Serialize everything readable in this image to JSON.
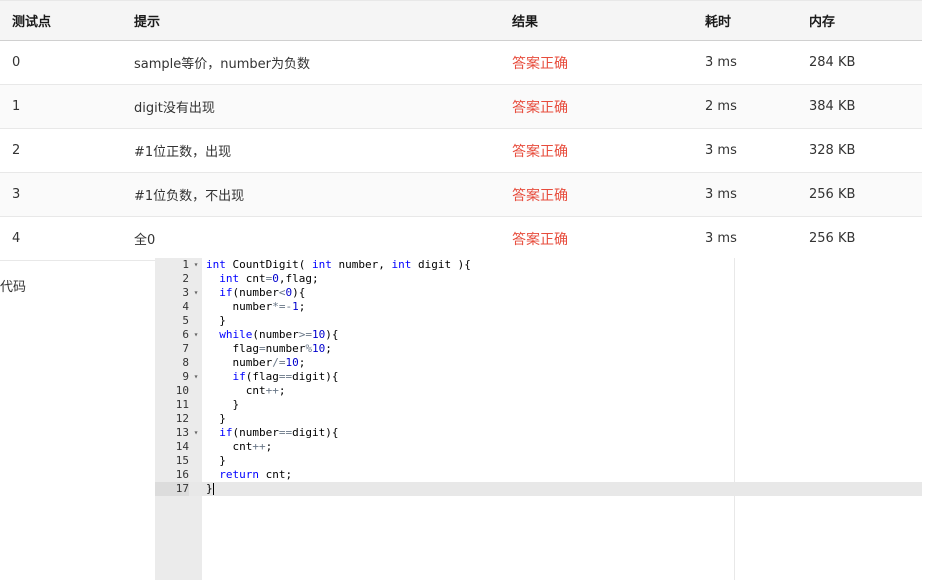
{
  "table": {
    "headers": {
      "case": "测试点",
      "hint": "提示",
      "result": "结果",
      "time": "耗时",
      "memory": "内存"
    },
    "rows": [
      {
        "case": "0",
        "hint": "sample等价，number为负数",
        "result": "答案正确",
        "time": "3 ms",
        "memory": "284 KB"
      },
      {
        "case": "1",
        "hint": "digit没有出现",
        "result": "答案正确",
        "time": "2 ms",
        "memory": "384 KB"
      },
      {
        "case": "2",
        "hint": "#1位正数，出现",
        "result": "答案正确",
        "time": "3 ms",
        "memory": "328 KB"
      },
      {
        "case": "3",
        "hint": "#1位负数，不出现",
        "result": "答案正确",
        "time": "3 ms",
        "memory": "256 KB"
      },
      {
        "case": "4",
        "hint": "全0",
        "result": "答案正确",
        "time": "3 ms",
        "memory": "256 KB"
      }
    ]
  },
  "code_label": "代码",
  "editor": {
    "active_line": 17,
    "colors": {
      "keyword": "#0000ff",
      "number": "#0000cd",
      "result": "#e74c3c"
    },
    "lines": [
      {
        "n": "1",
        "fold": true,
        "code": "int CountDigit( int number, int digit ){"
      },
      {
        "n": "2",
        "fold": false,
        "code": "  int cnt=0,flag;"
      },
      {
        "n": "3",
        "fold": true,
        "code": "  if(number<0){"
      },
      {
        "n": "4",
        "fold": false,
        "code": "    number*=-1;"
      },
      {
        "n": "5",
        "fold": false,
        "code": "  }"
      },
      {
        "n": "6",
        "fold": true,
        "code": "  while(number>=10){"
      },
      {
        "n": "7",
        "fold": false,
        "code": "    flag=number%10;"
      },
      {
        "n": "8",
        "fold": false,
        "code": "    number/=10;"
      },
      {
        "n": "9",
        "fold": true,
        "code": "    if(flag==digit){"
      },
      {
        "n": "10",
        "fold": false,
        "code": "      cnt++;"
      },
      {
        "n": "11",
        "fold": false,
        "code": "    }"
      },
      {
        "n": "12",
        "fold": false,
        "code": "  }"
      },
      {
        "n": "13",
        "fold": true,
        "code": "  if(number==digit){"
      },
      {
        "n": "14",
        "fold": false,
        "code": "    cnt++;"
      },
      {
        "n": "15",
        "fold": false,
        "code": "  }"
      },
      {
        "n": "16",
        "fold": false,
        "code": "  return cnt;"
      },
      {
        "n": "17",
        "fold": false,
        "code": "}"
      }
    ]
  }
}
